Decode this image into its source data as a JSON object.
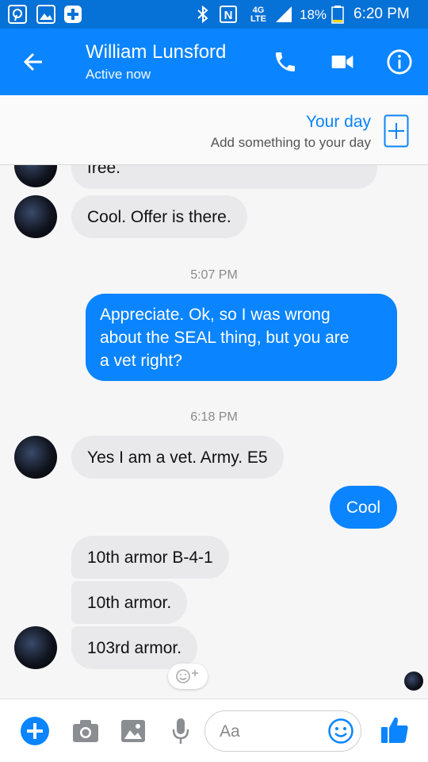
{
  "status_bar": {
    "battery": "18%",
    "time": "6:20 PM",
    "network": "4G LTE"
  },
  "header": {
    "contact_name": "William Lunsford",
    "status": "Active now",
    "icons": [
      "back-arrow-icon",
      "phone-icon",
      "video-camera-icon",
      "info-icon"
    ]
  },
  "your_day": {
    "title": "Your day",
    "subtitle": "Add something to your day"
  },
  "messages": [
    {
      "sender": "them",
      "text": "free."
    },
    {
      "sender": "them",
      "text": "Cool. Offer is there."
    },
    {
      "timestamp": "5:07 PM"
    },
    {
      "sender": "me",
      "lines": [
        "Appreciate. Ok, so I was wrong",
        "about the SEAL thing, but you are",
        "a vet right?"
      ]
    },
    {
      "timestamp": "6:18 PM"
    },
    {
      "sender": "them",
      "text": "Yes I am a vet. Army. E5"
    },
    {
      "sender": "me",
      "text": "Cool"
    },
    {
      "sender": "them",
      "text": "10th armor B-4-1"
    },
    {
      "sender": "them",
      "text": "10th armor."
    },
    {
      "sender": "them",
      "text": "103rd armor."
    }
  ],
  "composer": {
    "placeholder": "Aa",
    "icons": [
      "plus-icon",
      "camera-icon",
      "image-icon",
      "microphone-icon",
      "emoji-icon",
      "thumbs-up-icon"
    ]
  },
  "colors": {
    "brand_blue": "#0a84ff",
    "status_bar_blue": "#0671d6",
    "incoming_bubble": "#e9e9eb",
    "battery_low": "#ffd600"
  }
}
